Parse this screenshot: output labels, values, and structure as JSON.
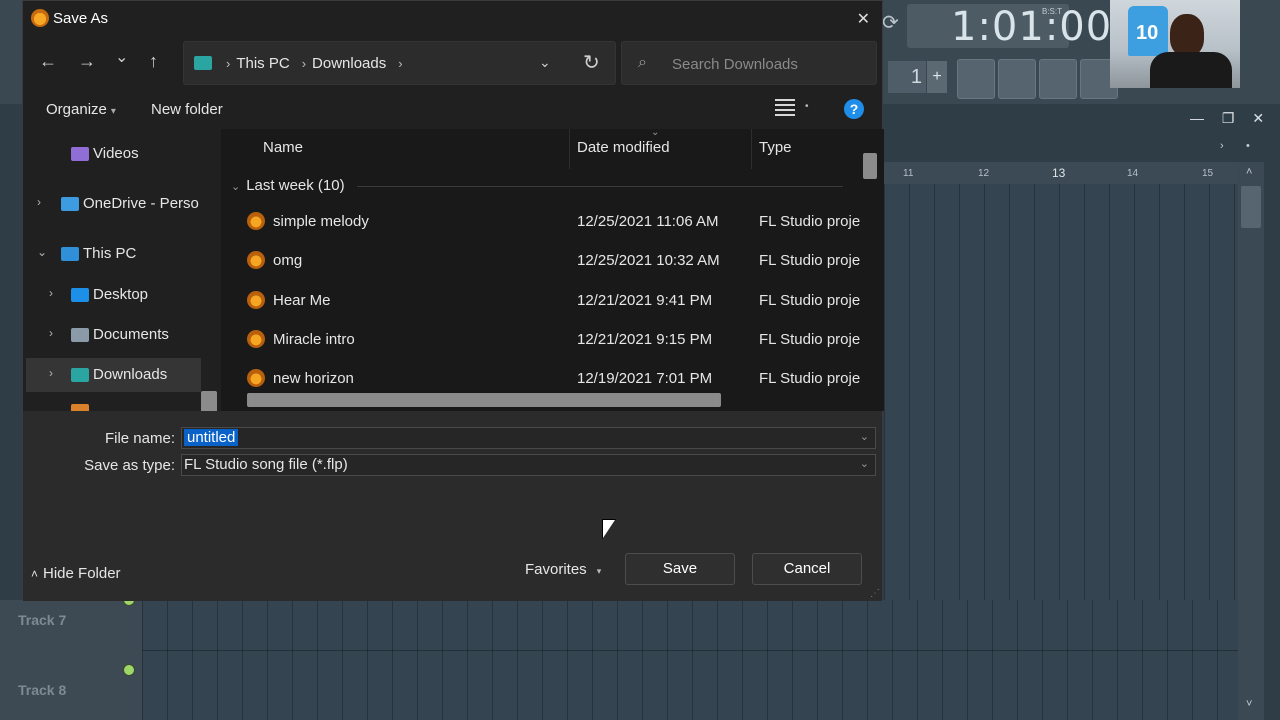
{
  "fl": {
    "clock": "1:01:00",
    "clock_sub": "B:S:T",
    "step": "1",
    "plus": "+",
    "ruler_ticks": [
      "11",
      "12",
      "13",
      "14",
      "15"
    ],
    "tracks": [
      "Track 7",
      "Track 8"
    ],
    "webcam_jersey_number": "10"
  },
  "dialog": {
    "title": "Save As",
    "close_label": "✕",
    "nav": {
      "back": "←",
      "forward": "→",
      "recent": "⌄",
      "up": "↑",
      "breadcrumb": [
        "This PC",
        "Downloads"
      ],
      "dropdown": "⌄",
      "refresh": "↻",
      "search_placeholder": "Search Downloads"
    },
    "commands": {
      "organize": "Organize",
      "new_folder": "New folder",
      "help": "?"
    },
    "nav_pane": [
      {
        "label": "Videos",
        "icon": "videos-icon",
        "expander": ""
      },
      {
        "label": "OneDrive - Perso",
        "icon": "onedrive-icon",
        "expander": "›"
      },
      {
        "label": "This PC",
        "icon": "this-pc-icon",
        "expander": "⌄"
      },
      {
        "label": "Desktop",
        "icon": "desktop-icon",
        "expander": "›"
      },
      {
        "label": "Documents",
        "icon": "documents-icon",
        "expander": "›"
      },
      {
        "label": "Downloads",
        "icon": "downloads-icon",
        "expander": "›",
        "selected": true
      }
    ],
    "columns": {
      "name": "Name",
      "date": "Date modified",
      "type": "Type"
    },
    "group": "Last week (10)",
    "files": [
      {
        "name": "simple melody",
        "date": "12/25/2021 11:06 AM",
        "type": "FL Studio proje"
      },
      {
        "name": "omg",
        "date": "12/25/2021 10:32 AM",
        "type": "FL Studio proje"
      },
      {
        "name": "Hear Me",
        "date": "12/21/2021 9:41 PM",
        "type": "FL Studio proje"
      },
      {
        "name": "Miracle intro",
        "date": "12/21/2021 9:15 PM",
        "type": "FL Studio proje"
      },
      {
        "name": "new horizon",
        "date": "12/19/2021 7:01 PM",
        "type": "FL Studio proje"
      }
    ],
    "form": {
      "file_name_label": "File name:",
      "file_name_value": "untitled",
      "type_label": "Save as type:",
      "type_value": "FL Studio song file (*.flp)"
    },
    "footer": {
      "hide_folder": "Hide Folder",
      "favorites": "Favorites",
      "save": "Save",
      "cancel": "Cancel"
    }
  },
  "colors": {
    "accent": "#1e8ee8",
    "selection": "#0a62c9",
    "dialog_bg": "#202020",
    "fl_bg": "#2f3d47"
  }
}
